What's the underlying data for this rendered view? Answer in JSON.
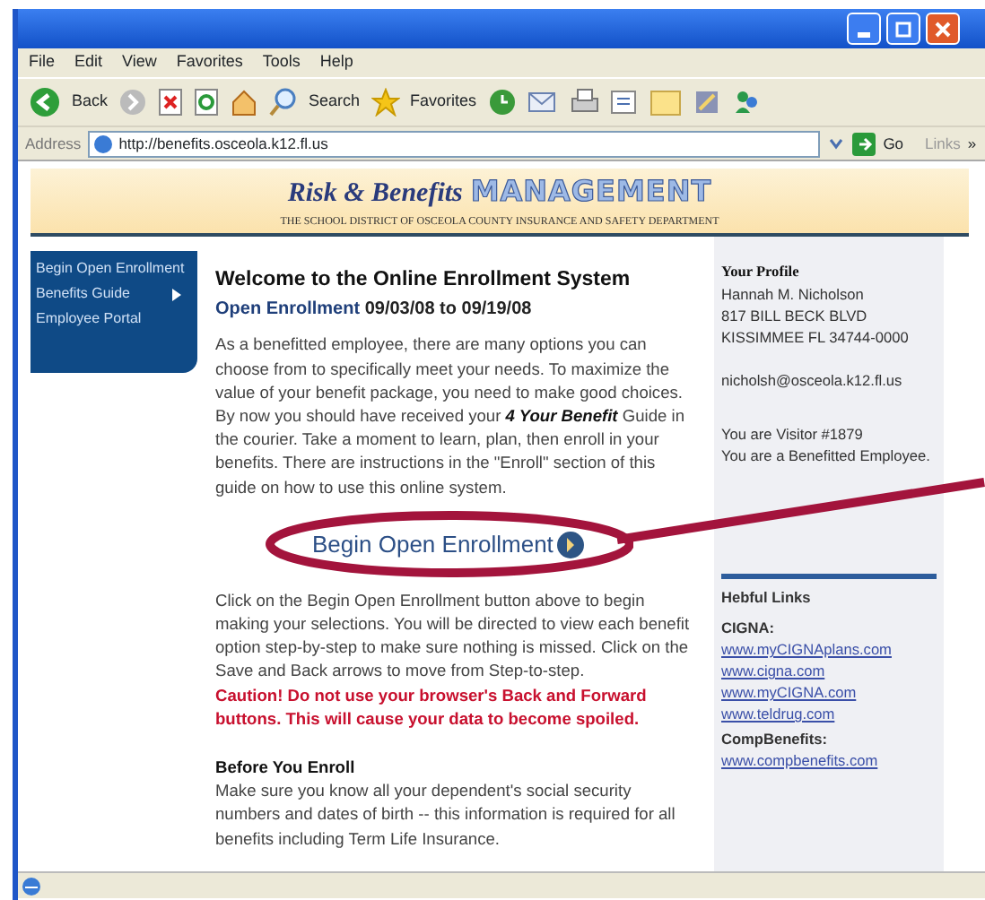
{
  "menu": [
    "File",
    "Edit",
    "View",
    "Favorites",
    "Tools",
    "Help"
  ],
  "toolbar": {
    "back": "Back",
    "search": "Search",
    "favorites": "Favorites"
  },
  "address": {
    "label": "Address",
    "value": "http://benefits.osceola.k12.fl.us",
    "go": "Go",
    "links": "Links",
    "more": "»"
  },
  "banner": {
    "title": "Risk & Benefits",
    "title_accent": "MANAGEMENT",
    "subtitle": "THE SCHOOL DISTRICT OF OSCEOLA COUNTY INSURANCE AND SAFETY DEPARTMENT"
  },
  "sidebar": {
    "items": [
      {
        "label": "Begin Open Enrollment",
        "submenu": false
      },
      {
        "label": "Benefits Guide",
        "submenu": true
      },
      {
        "label": "Employee Portal",
        "submenu": false
      }
    ]
  },
  "main": {
    "heading": "Welcome to the Online Enrollment System",
    "subheading": "Open Enrollment",
    "dates": "09/03/08 to 09/19/08",
    "intro": "As a benefitted employee, there are many options you can choose from to specifically meet your needs.  To maximize the value of your benefit package, you need to make good choices.  By now you should have received your **4 Your Benefit** Guide in the courier.  Take a moment to learn, plan, then enroll in your benefits.  There are instructions in the \"Enroll\" section of this guide on how to use this online system.",
    "button": "Begin Open Enrollment",
    "instructions": "Click on the Begin Open Enrollment button above to begin making your selections.  You will be directed to view each benefit option step-by-step to make sure nothing is missed.  Click on the Save and Back arrows to move from Step-to-step.",
    "caution": "Caution! Do not use your browser's Back and Forward buttons.  This will cause your data to become spoiled.",
    "before_heading": "Before You Enroll",
    "before_text": "Make sure you know all your dependent's social security numbers and dates of birth -- this information is required for all benefits including Term Life Insurance."
  },
  "profile": {
    "title": "Your Profile",
    "lines": [
      "Hannah M. Nicholson",
      "817 BILL BECK BLVD",
      "KISSIMMEE  FL  34744-0000"
    ],
    "email": "nicholsh@osceola.k12.fl.us",
    "visitor": [
      "You are Visitor #1879",
      "You are a Benefitted Employee."
    ]
  },
  "helpful_links": {
    "title": "Hebful Links",
    "groups": [
      {
        "name": "CIGNA:",
        "links": [
          "www.myCIGNAplans.com",
          "www.cigna.com",
          "www.myCIGNA.com",
          "www.teldrug.com"
        ]
      },
      {
        "name": "CompBenefits:",
        "links": [
          "www.compbenefits.com"
        ]
      }
    ]
  }
}
